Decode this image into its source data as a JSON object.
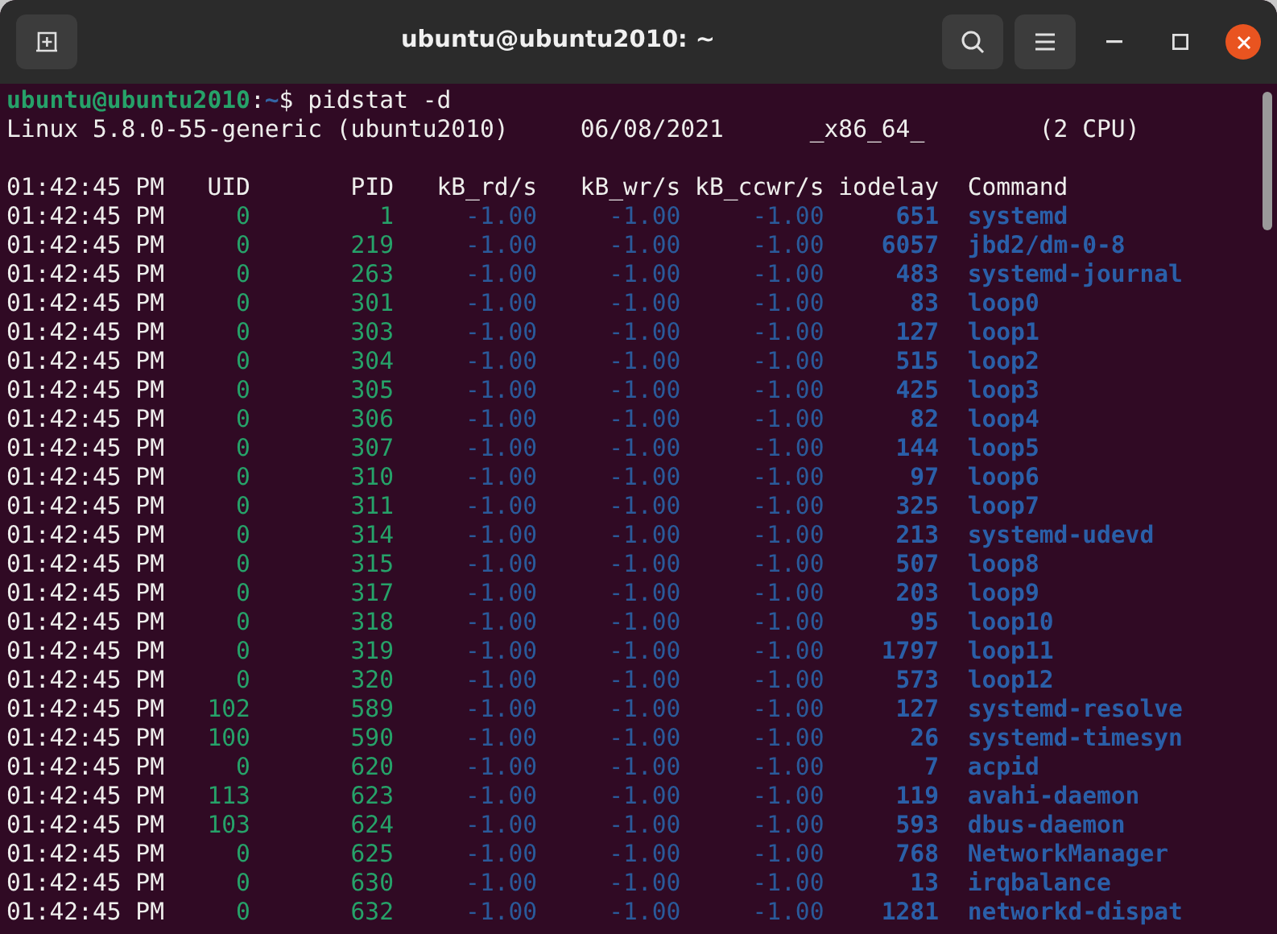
{
  "window": {
    "title": "ubuntu@ubuntu2010: ~"
  },
  "prompt": {
    "user": "ubuntu@ubuntu2010",
    "separator": ":",
    "path": "~",
    "command": "$ pidstat -d"
  },
  "sysinfo": [
    "Linux 5.8.0-55-generic (ubuntu2010)",
    "06/08/2021",
    "_x86_64_",
    "(2 CPU)"
  ],
  "table": {
    "columns": [
      "01:42:45 PM",
      "UID",
      "PID",
      "kB_rd/s",
      "kB_wr/s",
      "kB_ccwr/s",
      "iodelay",
      "Command"
    ],
    "rows": [
      [
        "01:42:45 PM",
        "0",
        "1",
        "-1.00",
        "-1.00",
        "-1.00",
        "651",
        "systemd"
      ],
      [
        "01:42:45 PM",
        "0",
        "219",
        "-1.00",
        "-1.00",
        "-1.00",
        "6057",
        "jbd2/dm-0-8"
      ],
      [
        "01:42:45 PM",
        "0",
        "263",
        "-1.00",
        "-1.00",
        "-1.00",
        "483",
        "systemd-journal"
      ],
      [
        "01:42:45 PM",
        "0",
        "301",
        "-1.00",
        "-1.00",
        "-1.00",
        "83",
        "loop0"
      ],
      [
        "01:42:45 PM",
        "0",
        "303",
        "-1.00",
        "-1.00",
        "-1.00",
        "127",
        "loop1"
      ],
      [
        "01:42:45 PM",
        "0",
        "304",
        "-1.00",
        "-1.00",
        "-1.00",
        "515",
        "loop2"
      ],
      [
        "01:42:45 PM",
        "0",
        "305",
        "-1.00",
        "-1.00",
        "-1.00",
        "425",
        "loop3"
      ],
      [
        "01:42:45 PM",
        "0",
        "306",
        "-1.00",
        "-1.00",
        "-1.00",
        "82",
        "loop4"
      ],
      [
        "01:42:45 PM",
        "0",
        "307",
        "-1.00",
        "-1.00",
        "-1.00",
        "144",
        "loop5"
      ],
      [
        "01:42:45 PM",
        "0",
        "310",
        "-1.00",
        "-1.00",
        "-1.00",
        "97",
        "loop6"
      ],
      [
        "01:42:45 PM",
        "0",
        "311",
        "-1.00",
        "-1.00",
        "-1.00",
        "325",
        "loop7"
      ],
      [
        "01:42:45 PM",
        "0",
        "314",
        "-1.00",
        "-1.00",
        "-1.00",
        "213",
        "systemd-udevd"
      ],
      [
        "01:42:45 PM",
        "0",
        "315",
        "-1.00",
        "-1.00",
        "-1.00",
        "507",
        "loop8"
      ],
      [
        "01:42:45 PM",
        "0",
        "317",
        "-1.00",
        "-1.00",
        "-1.00",
        "203",
        "loop9"
      ],
      [
        "01:42:45 PM",
        "0",
        "318",
        "-1.00",
        "-1.00",
        "-1.00",
        "95",
        "loop10"
      ],
      [
        "01:42:45 PM",
        "0",
        "319",
        "-1.00",
        "-1.00",
        "-1.00",
        "1797",
        "loop11"
      ],
      [
        "01:42:45 PM",
        "0",
        "320",
        "-1.00",
        "-1.00",
        "-1.00",
        "573",
        "loop12"
      ],
      [
        "01:42:45 PM",
        "102",
        "589",
        "-1.00",
        "-1.00",
        "-1.00",
        "127",
        "systemd-resolve"
      ],
      [
        "01:42:45 PM",
        "100",
        "590",
        "-1.00",
        "-1.00",
        "-1.00",
        "26",
        "systemd-timesyn"
      ],
      [
        "01:42:45 PM",
        "0",
        "620",
        "-1.00",
        "-1.00",
        "-1.00",
        "7",
        "acpid"
      ],
      [
        "01:42:45 PM",
        "113",
        "623",
        "-1.00",
        "-1.00",
        "-1.00",
        "119",
        "avahi-daemon"
      ],
      [
        "01:42:45 PM",
        "103",
        "624",
        "-1.00",
        "-1.00",
        "-1.00",
        "593",
        "dbus-daemon"
      ],
      [
        "01:42:45 PM",
        "0",
        "625",
        "-1.00",
        "-1.00",
        "-1.00",
        "768",
        "NetworkManager"
      ],
      [
        "01:42:45 PM",
        "0",
        "630",
        "-1.00",
        "-1.00",
        "-1.00",
        "13",
        "irqbalance"
      ],
      [
        "01:42:45 PM",
        "0",
        "632",
        "-1.00",
        "-1.00",
        "-1.00",
        "1281",
        "networkd-dispat"
      ]
    ]
  }
}
